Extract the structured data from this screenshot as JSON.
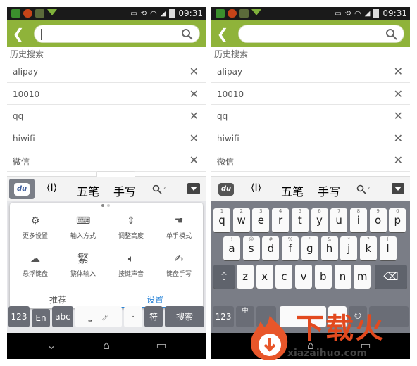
{
  "status": {
    "time": "09:31"
  },
  "search": {
    "placeholder": ""
  },
  "history": {
    "title": "历史搜索",
    "items": [
      {
        "label": "alipay"
      },
      {
        "label": "10010"
      },
      {
        "label": "qq"
      },
      {
        "label": "hiwifi"
      },
      {
        "label": "微信"
      }
    ]
  },
  "toolbar": {
    "du": "du",
    "wubi": "五笔",
    "handwrite": "手写"
  },
  "settings": {
    "items": [
      {
        "label": "更多设置"
      },
      {
        "label": "输入方式"
      },
      {
        "label": "调整高度"
      },
      {
        "label": "单手模式"
      },
      {
        "label": "悬浮键盘"
      },
      {
        "label": "繁体输入",
        "glyph": "繁"
      },
      {
        "label": "按键声音"
      },
      {
        "label": "键盘手写"
      }
    ],
    "tabs": {
      "recommend": "推荐",
      "settings": "设置"
    }
  },
  "keyboard_left": {
    "k123": "123",
    "en": "En",
    "abc": "abc",
    "dot": "·",
    "fu": "符",
    "search": "搜索"
  },
  "keyboard_right": {
    "row1": [
      {
        "k": "q",
        "s": "1"
      },
      {
        "k": "w",
        "s": "2"
      },
      {
        "k": "e",
        "s": "3"
      },
      {
        "k": "r",
        "s": "4"
      },
      {
        "k": "t",
        "s": "5"
      },
      {
        "k": "y",
        "s": "6"
      },
      {
        "k": "u",
        "s": "7"
      },
      {
        "k": "i",
        "s": "8"
      },
      {
        "k": "o",
        "s": "9"
      },
      {
        "k": "p",
        "s": "0"
      }
    ],
    "row2": [
      {
        "k": "a",
        "s": "!"
      },
      {
        "k": "s",
        "s": "@"
      },
      {
        "k": "d",
        "s": "#"
      },
      {
        "k": "f",
        "s": "%"
      },
      {
        "k": "g",
        "s": "'"
      },
      {
        "k": "h",
        "s": "&"
      },
      {
        "k": "j",
        "s": "*"
      },
      {
        "k": "k",
        "s": "?"
      },
      {
        "k": "l",
        "s": "("
      }
    ],
    "row3": [
      {
        "k": "z",
        "s": ""
      },
      {
        "k": "x",
        "s": ""
      },
      {
        "k": "c",
        "s": ""
      },
      {
        "k": "v",
        "s": ""
      },
      {
        "k": "b",
        "s": ""
      },
      {
        "k": "n",
        "s": ""
      },
      {
        "k": "m",
        "s": ""
      }
    ],
    "k123": "123",
    "zhong": "中",
    "comma": "，",
    "emoji": "☺"
  },
  "watermark": {
    "text": "下载火",
    "url": "xiazaihuo.com"
  }
}
